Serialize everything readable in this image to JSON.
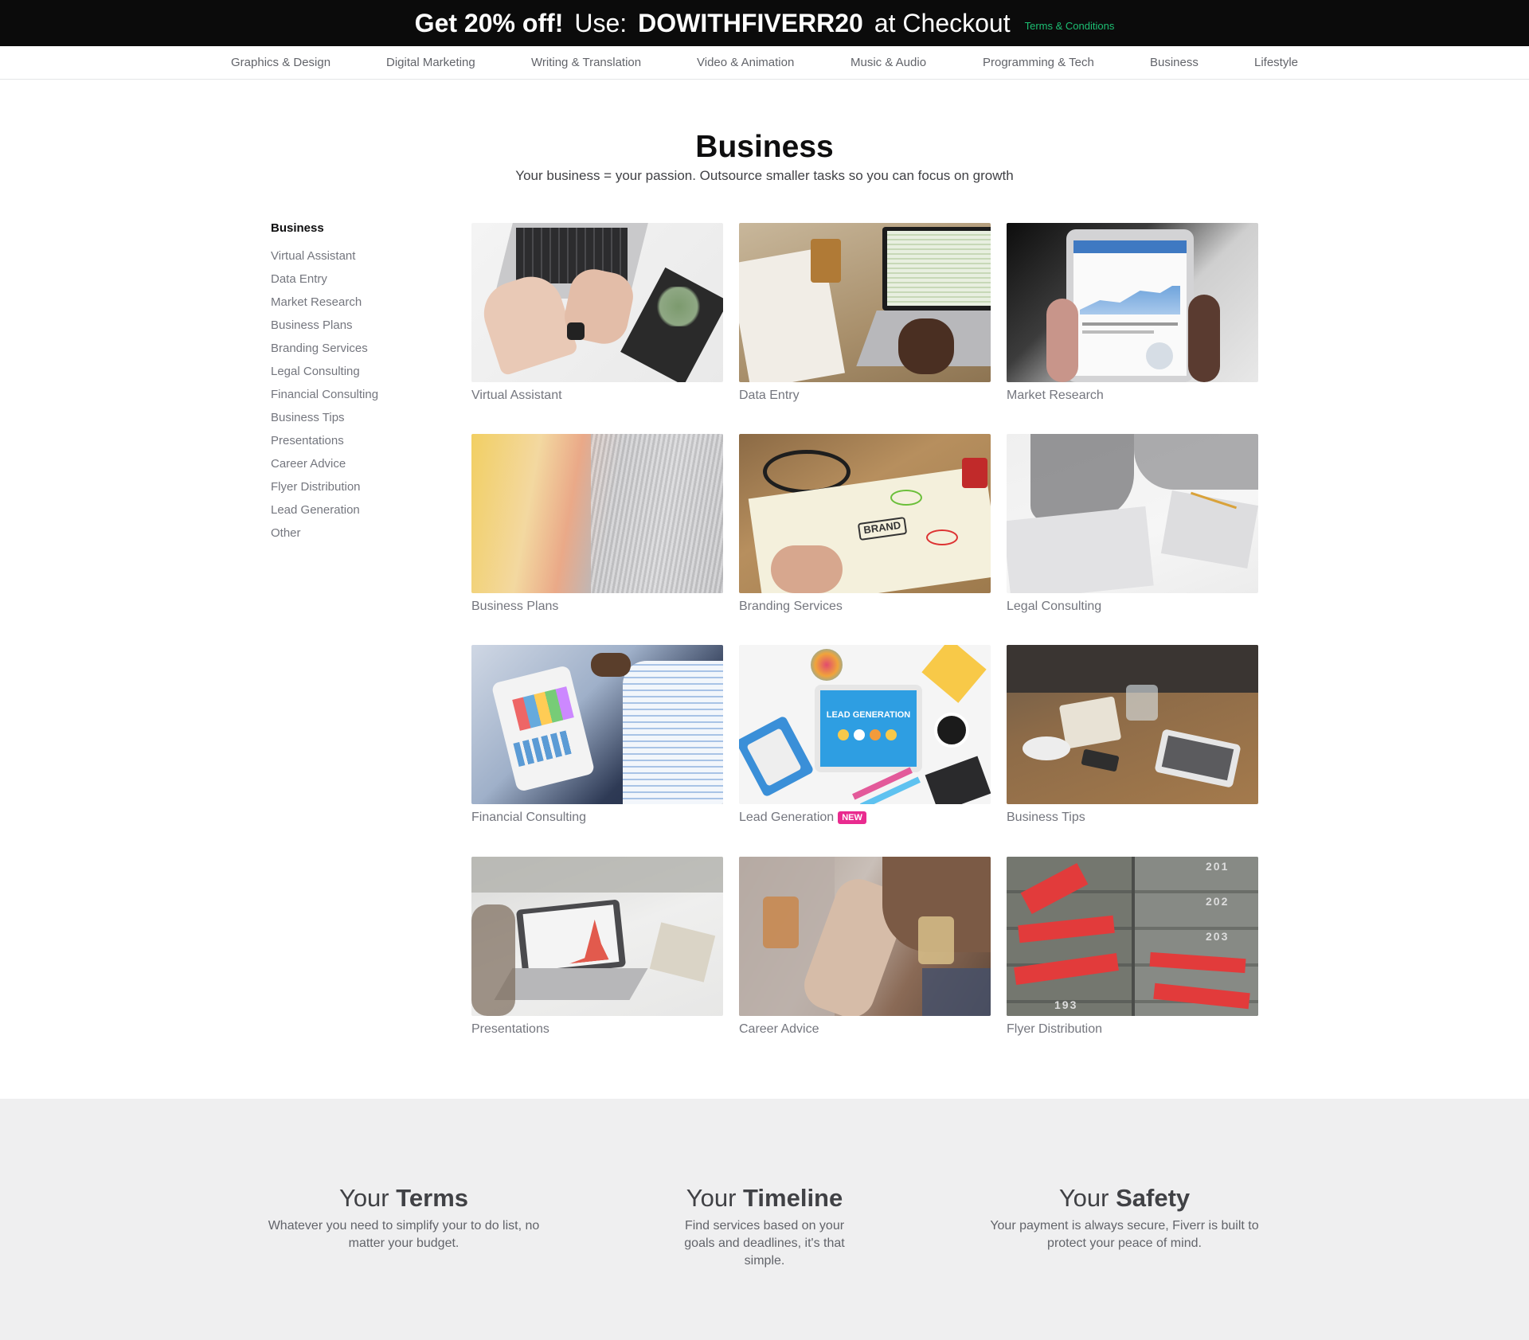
{
  "promo": {
    "part1": "Get 20% off!",
    "part2": "Use:",
    "code": "DOWITHFIVERR20",
    "part3": "at Checkout",
    "terms": "Terms & Conditions"
  },
  "categories": [
    "Graphics & Design",
    "Digital Marketing",
    "Writing & Translation",
    "Video & Animation",
    "Music & Audio",
    "Programming & Tech",
    "Business",
    "Lifestyle"
  ],
  "page": {
    "title": "Business",
    "subtitle": "Your business = your passion. Outsource smaller tasks so you can focus on growth"
  },
  "sidebar": {
    "heading": "Business",
    "items": [
      "Virtual Assistant",
      "Data Entry",
      "Market Research",
      "Business Plans",
      "Branding Services",
      "Legal Consulting",
      "Financial Consulting",
      "Business Tips",
      "Presentations",
      "Career Advice",
      "Flyer Distribution",
      "Lead Generation",
      "Other"
    ]
  },
  "cards": [
    {
      "label": "Virtual Assistant"
    },
    {
      "label": "Data Entry"
    },
    {
      "label": "Market Research"
    },
    {
      "label": "Business Plans"
    },
    {
      "label": "Branding Services"
    },
    {
      "label": "Legal Consulting"
    },
    {
      "label": "Financial Consulting"
    },
    {
      "label": "Lead Generation",
      "badge": "NEW"
    },
    {
      "label": "Business Tips"
    },
    {
      "label": "Presentations"
    },
    {
      "label": "Career Advice"
    },
    {
      "label": "Flyer Distribution"
    }
  ],
  "thumb_text": {
    "lead_screen": "LEAD GENERATION",
    "brand_word": "BRAND",
    "mailbox_numbers": [
      "201",
      "202",
      "203",
      "193"
    ]
  },
  "features": [
    {
      "title_light": "Your",
      "title_bold": "Terms",
      "text": "Whatever you need to simplify your to do list, no matter your budget."
    },
    {
      "title_light": "Your",
      "title_bold": "Timeline",
      "text": "Find services based on your goals and deadlines, it's that simple."
    },
    {
      "title_light": "Your",
      "title_bold": "Safety",
      "text": "Your payment is always secure, Fiverr is built to protect your peace of mind."
    }
  ],
  "colors": {
    "brand_green": "#1dbf73",
    "new_badge": "#e92b8f",
    "banner_bg": "#0b0b0b",
    "footer_bg": "#efeff0"
  }
}
